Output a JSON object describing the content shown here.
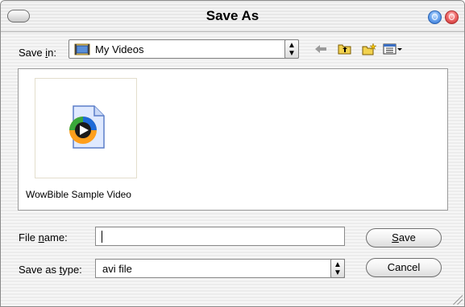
{
  "window": {
    "title": "Save As"
  },
  "save_in": {
    "label_pre": "Save ",
    "label_accel": "i",
    "label_post": "n:",
    "location": "My Videos",
    "icons": [
      "back-arrow-icon",
      "up-folder-icon",
      "new-folder-icon",
      "view-menu-icon"
    ]
  },
  "files": [
    {
      "name": "WowBible Sample Video",
      "icon": "media-file-icon"
    }
  ],
  "file_name": {
    "label_pre": "File ",
    "label_accel": "n",
    "label_post": "ame:",
    "value": ""
  },
  "save_as_type": {
    "label_pre": "Save as ",
    "label_accel": "t",
    "label_post": "ype:",
    "value": "avi file"
  },
  "buttons": {
    "save_accel": "S",
    "save_rest": "ave",
    "cancel": "Cancel"
  },
  "colors": {
    "minimize": "#2f6fd0",
    "close": "#c42a2a"
  }
}
